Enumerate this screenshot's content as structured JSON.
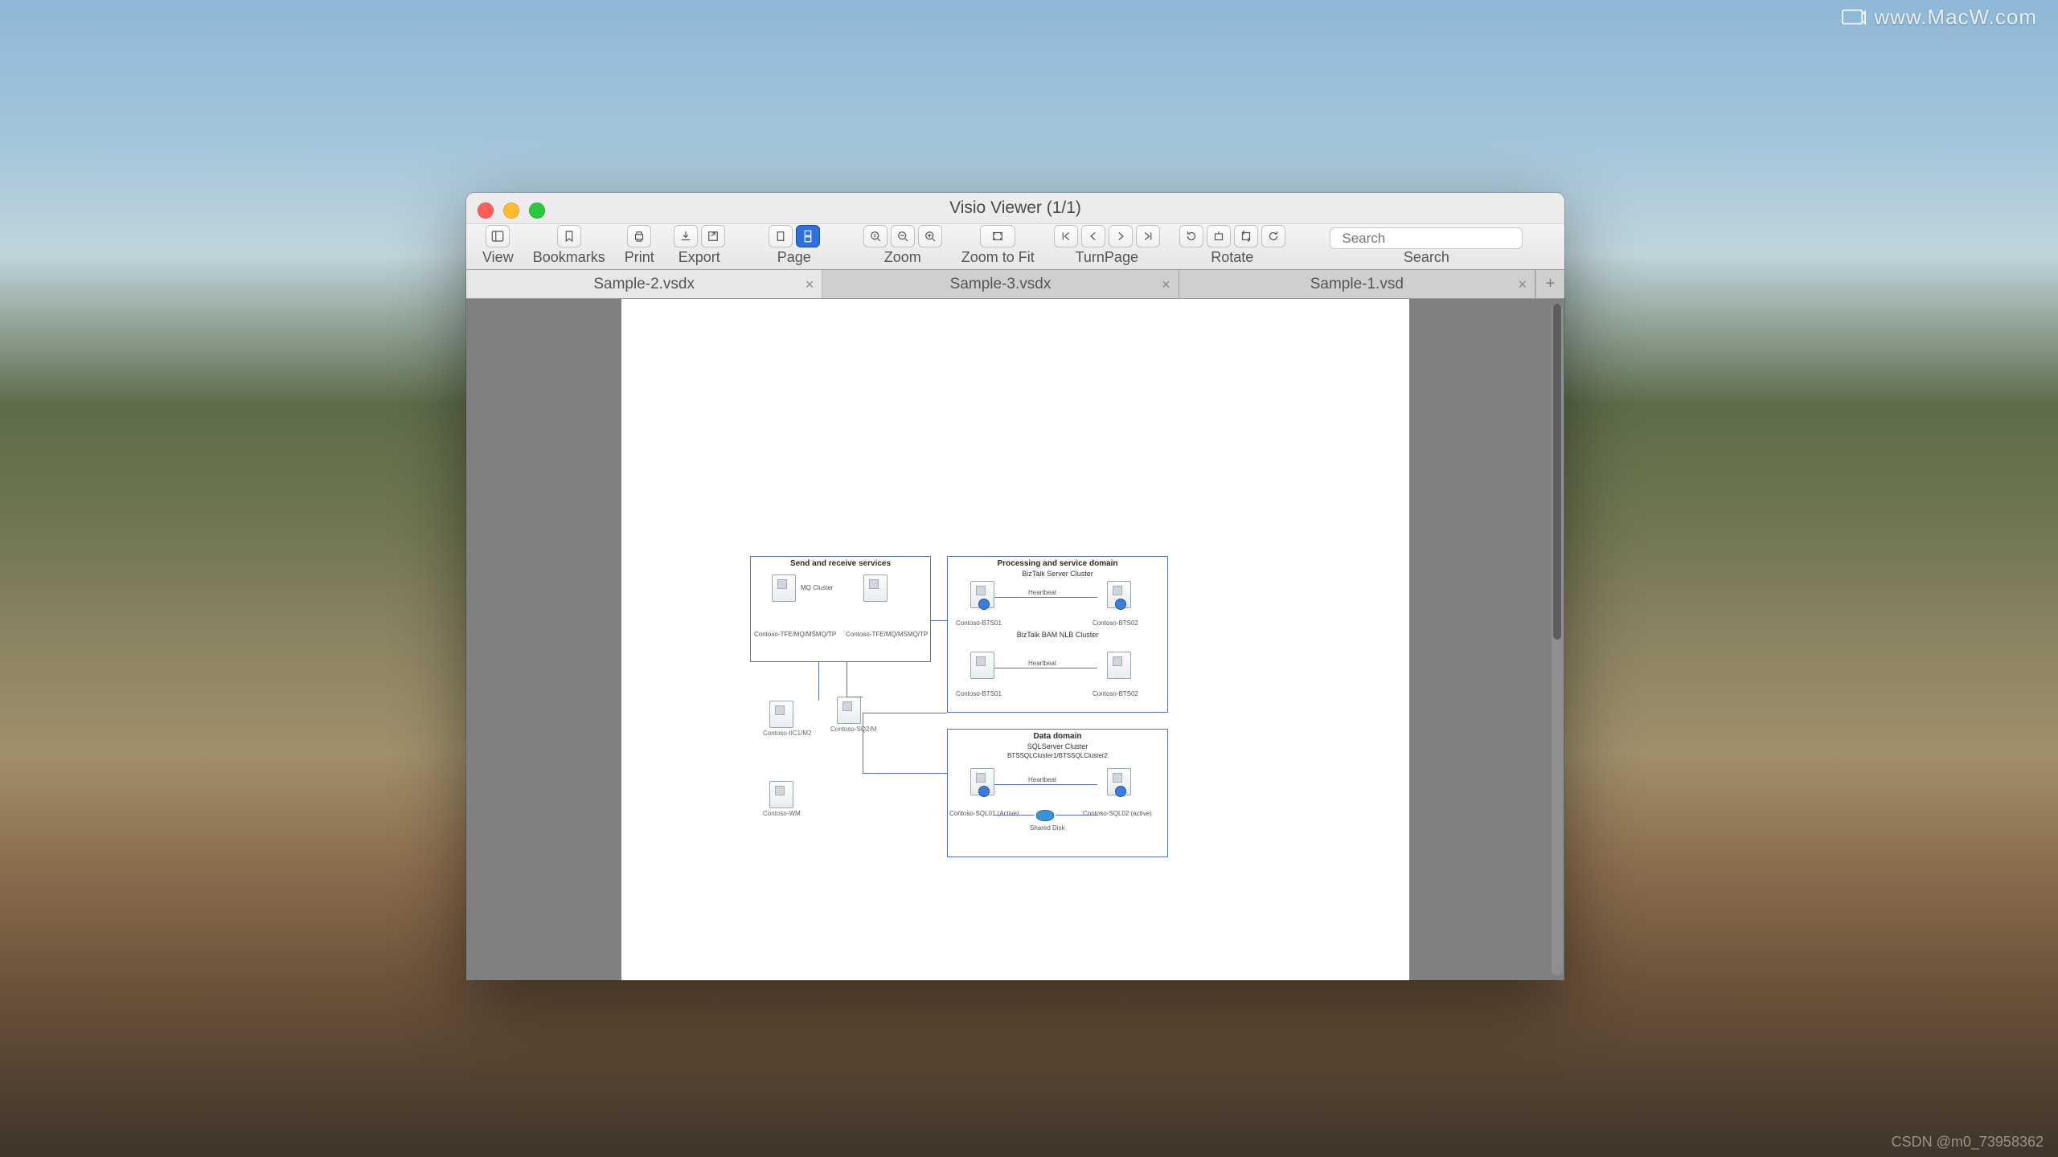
{
  "watermark": {
    "top_right": "www.MacW.com",
    "bottom_right": "CSDN @m0_73958362"
  },
  "window": {
    "title": "Visio Viewer (1/1)",
    "toolbar": {
      "view": "View",
      "bookmarks": "Bookmarks",
      "print": "Print",
      "export": "Export",
      "page": "Page",
      "zoom": "Zoom",
      "zoom_to_fit": "Zoom to Fit",
      "turnpage": "TurnPage",
      "rotate": "Rotate",
      "search_label": "Search",
      "search_placeholder": "Search"
    },
    "tabs": [
      {
        "label": "Sample-2.vsdx",
        "active": true
      },
      {
        "label": "Sample-3.vsdx",
        "active": false
      },
      {
        "label": "Sample-1.vsd",
        "active": false
      }
    ]
  },
  "diagram": {
    "box1": {
      "title": "Send and receive services",
      "srv1_label": "MQ Cluster",
      "srv1_cap": "Contoso-TFE/MQ/MSMQ/TP",
      "srv2_cap": "Contoso-TFE/MQ/MSMQ/TP"
    },
    "box2": {
      "title": "Processing and service domain",
      "sub1": "BizTalk Server Cluster",
      "hb": "Heartbeat",
      "cap_l1": "Contoso-BTS01",
      "cap_r1": "Contoso-BTS02",
      "sub2": "BizTalk BAM NLB Cluster",
      "cap_l2": "Contoso-BTS01",
      "cap_r2": "Contoso-BTS02"
    },
    "loose": {
      "s1": "Contoso-IIC1/M2",
      "s2": "Contoso-SQ2/M",
      "s3": "Contoso-WM"
    },
    "box3": {
      "title": "Data domain",
      "sub1": "SQLServer Cluster",
      "sub2": "BTSSQLCluster1/BTSSQLCluster2",
      "hb": "Heartbeat",
      "cap_l": "Contoso-SQL01 (Active)",
      "cap_r": "Contoso-SQL02 (active)",
      "shared": "Shared Disk"
    }
  }
}
